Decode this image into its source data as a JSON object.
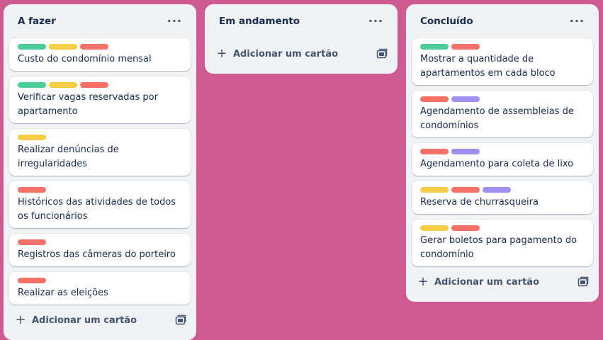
{
  "colors": {
    "background": "#cd5a91",
    "green": "#4bce97",
    "yellow": "#f5cd47",
    "red": "#f87168",
    "purple": "#9f8fef"
  },
  "more_icon_glyph": "···",
  "plus_glyph": "+",
  "lists": [
    {
      "title": "A fazer",
      "add_label": "Adicionar um cartão",
      "cards": [
        {
          "labels": [
            "green",
            "yellow",
            "red"
          ],
          "title": "Custo do condomínio mensal"
        },
        {
          "labels": [
            "green",
            "yellow",
            "red"
          ],
          "title": "Verificar vagas reservadas por apartamento"
        },
        {
          "labels": [
            "yellow"
          ],
          "title": "Realizar denúncias de irregularidades"
        },
        {
          "labels": [
            "red"
          ],
          "title": "Históricos das atividades de todos os funcionários"
        },
        {
          "labels": [
            "red"
          ],
          "title": "Registros das câmeras do porteiro"
        },
        {
          "labels": [
            "red"
          ],
          "title": "Realizar as eleições"
        }
      ]
    },
    {
      "title": "Em andamento",
      "add_label": "Adicionar um cartão",
      "cards": []
    },
    {
      "title": "Concluído",
      "add_label": "Adicionar um cartão",
      "cards": [
        {
          "labels": [
            "green",
            "red"
          ],
          "title": "Mostrar a quantidade de apartamentos em cada bloco"
        },
        {
          "labels": [
            "red",
            "purple"
          ],
          "title": "Agendamento de assembleias de condomínios"
        },
        {
          "labels": [
            "red",
            "purple"
          ],
          "title": "Agendamento para coleta de lixo"
        },
        {
          "labels": [
            "yellow",
            "red",
            "purple"
          ],
          "title": "Reserva de churrasqueira"
        },
        {
          "labels": [
            "yellow",
            "red"
          ],
          "title": "Gerar boletos para pagamento do condomínio"
        }
      ]
    }
  ]
}
